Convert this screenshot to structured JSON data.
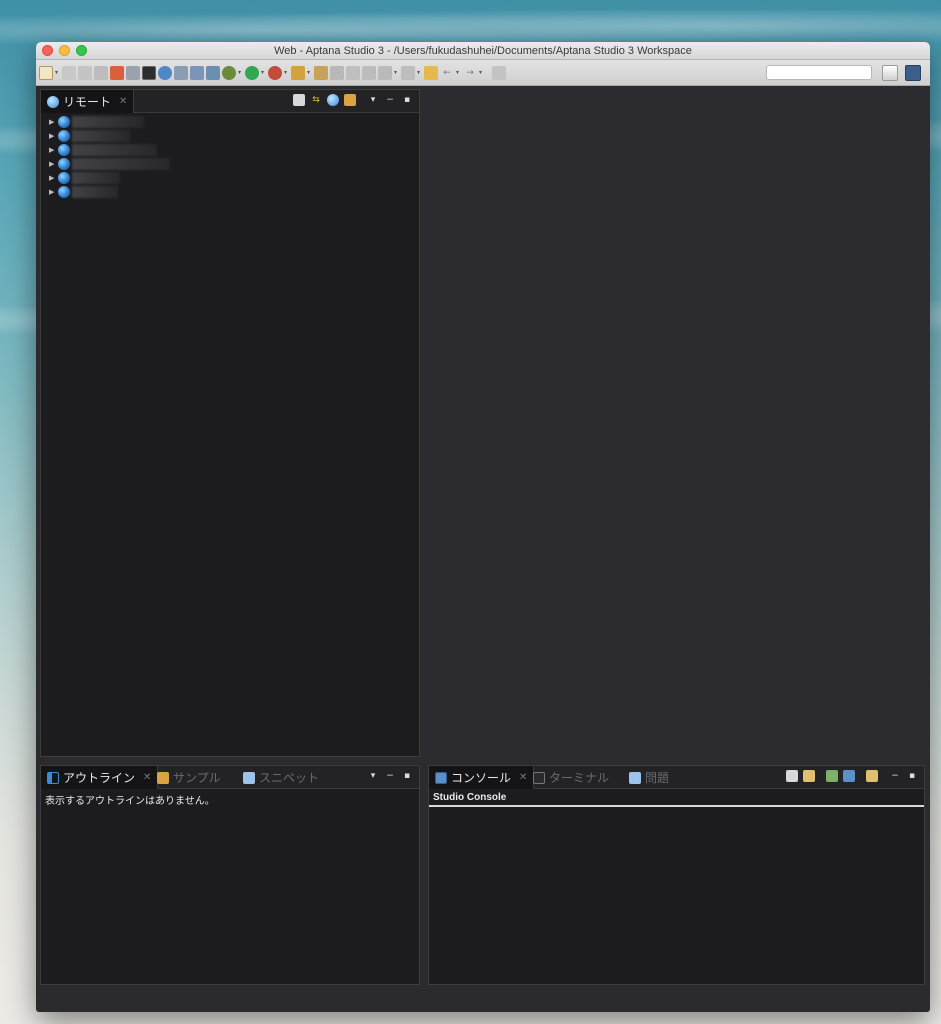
{
  "window": {
    "title": "Web - Aptana Studio 3 - /Users/fukudashuhei/Documents/Aptana Studio 3 Workspace"
  },
  "toolbar": {
    "search": {
      "value": "",
      "placeholder": ""
    },
    "icons": [
      "new-icon",
      "save-icon",
      "save-all-icon",
      "print-icon",
      "home-icon",
      "browser-icon",
      "terminal-icon",
      "gear-icon",
      "link-icon",
      "bug-icon",
      "deploy-icon",
      "build-icon",
      "run-icon",
      "debug-icon",
      "tool-icon",
      "folder-icon",
      "pencil-icon",
      "annotation-icon",
      "next-annotation-icon",
      "prev-annotation-icon",
      "back-icon",
      "forward-icon",
      "pin-icon"
    ]
  },
  "remote_panel": {
    "tab_label": "リモート",
    "tools": [
      "collapse-icon",
      "sync-icon",
      "new-connection-icon",
      "package-icon",
      "view-menu-icon",
      "minimize-icon",
      "maximize-icon"
    ],
    "items": [
      "",
      "",
      "",
      "",
      "",
      ""
    ]
  },
  "outline_panel": {
    "tabs": [
      {
        "label": "アウトライン",
        "active": true
      },
      {
        "label": "サンプル",
        "active": false
      },
      {
        "label": "スニペット",
        "active": false
      }
    ],
    "message": "表示するアウトラインはありません。"
  },
  "console_panel": {
    "tabs": [
      {
        "label": "コンソール",
        "active": true
      },
      {
        "label": "ターミナル",
        "active": false
      },
      {
        "label": "問題",
        "active": false
      }
    ],
    "console_name": "Studio Console"
  },
  "colors": {
    "panel_bg": "#1c1c1e",
    "editor_bg": "#2c2c30",
    "accent_globe": "#2f7fd0"
  }
}
